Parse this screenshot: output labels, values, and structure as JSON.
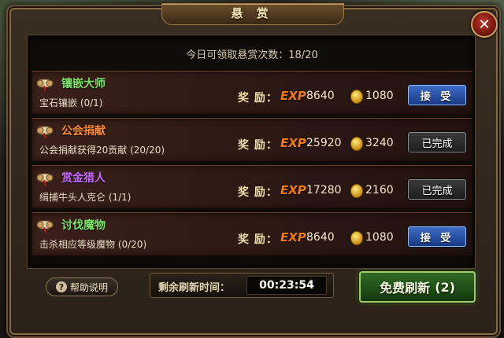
{
  "window": {
    "title": "悬 赏"
  },
  "daily": {
    "text": "今日可领取悬赏次数：18/20"
  },
  "tasks": [
    {
      "title": "镶嵌大师",
      "title_color": "#7be36b",
      "desc": "宝石镶嵌 (0/1)",
      "reward_label": "奖 励：",
      "exp_tag": "EXP",
      "exp": "8640",
      "gold": "1080",
      "button": "接 受",
      "state": "accept"
    },
    {
      "title": "公会捐献",
      "title_color": "#ff8a3a",
      "desc": "公会捐献获得20贡献 (20/20)",
      "reward_label": "奖 励：",
      "exp_tag": "EXP",
      "exp": "25920",
      "gold": "3240",
      "button": "已完成",
      "state": "done"
    },
    {
      "title": "赏金猎人",
      "title_color": "#c66bff",
      "desc": "缉捕牛头人克仑 (1/1)",
      "reward_label": "奖 励：",
      "exp_tag": "EXP",
      "exp": "17280",
      "gold": "2160",
      "button": "已完成",
      "state": "done"
    },
    {
      "title": "讨伐魔物",
      "title_color": "#7be36b",
      "desc": "击杀相应等级魔物 (0/20)",
      "reward_label": "奖 励：",
      "exp_tag": "EXP",
      "exp": "8640",
      "gold": "1080",
      "button": "接 受",
      "state": "accept"
    }
  ],
  "footer": {
    "help_label": "帮助说明",
    "timer_label": "剩余刷新时间：",
    "timer_value": "00:23:54",
    "refresh_label": "免费刷新",
    "refresh_count": "(2)"
  },
  "icons": {
    "close": "close-icon",
    "help": "question-icon",
    "scroll": "scroll-icon",
    "gold": "gold-coin-icon"
  }
}
